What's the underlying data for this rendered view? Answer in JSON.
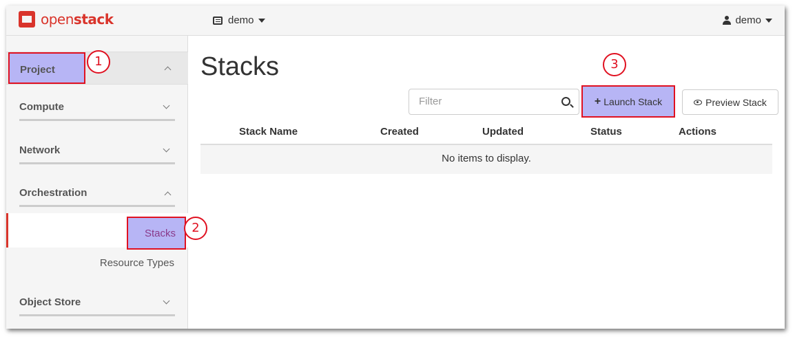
{
  "brand": {
    "open": "open",
    "stack": "stack"
  },
  "header": {
    "project_label": "demo",
    "user_label": "demo"
  },
  "sidebar": {
    "project": "Project",
    "compute": "Compute",
    "network": "Network",
    "orchestration": "Orchestration",
    "stacks": "Stacks",
    "resource_types": "Resource Types",
    "object_store": "Object Store"
  },
  "main": {
    "title": "Stacks",
    "filter_placeholder": "Filter",
    "launch_button": "Launch Stack",
    "preview_button": "Preview Stack",
    "columns": [
      "Stack Name",
      "Created",
      "Updated",
      "Status",
      "Actions"
    ],
    "empty_text": "No items to display."
  },
  "annotations": [
    "1",
    "2",
    "3"
  ],
  "colors": {
    "accent": "#d9342b",
    "highlight": "#b7b5f5",
    "annotation": "#e01020"
  }
}
